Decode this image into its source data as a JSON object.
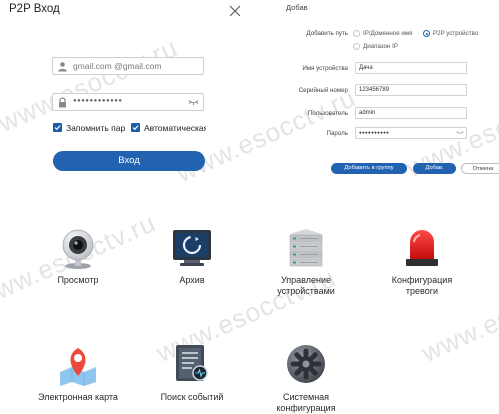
{
  "watermark": {
    "text": "www.esocctv.ru"
  },
  "login": {
    "title": "P2P Вход",
    "email_value": "gmail.com @gmail.com",
    "password_value": "●●●●●●●●●●●●",
    "remember_label": "Запомнить пар",
    "auto_label": "Автоматическая",
    "login_button": "Вход",
    "accent": "#2163b0"
  },
  "add_dialog": {
    "title": "Добав",
    "add_method_label": "Добавить путь",
    "options": {
      "ip": "IP/Доменное имя",
      "p2p": "P2P устройство",
      "range": "Диапазон IP"
    },
    "selected": "p2p",
    "fields": {
      "name": {
        "label": "Имя устройства",
        "value": "Дача"
      },
      "serial": {
        "label": "Серийный номер",
        "value": "123456789"
      },
      "user": {
        "label": "Пользователь",
        "value": "admin"
      },
      "pass": {
        "label": "Пароль",
        "value": "●●●●●●●●●●"
      }
    },
    "buttons": {
      "add_to_group": "Добавить в группу",
      "add": "Добав.",
      "cancel": "Отмена"
    }
  },
  "launcher": {
    "tiles": [
      {
        "label": "Просмотр",
        "icon": "webcam-icon"
      },
      {
        "label": "Архив",
        "icon": "archive-playback-icon"
      },
      {
        "label_1": "Управление",
        "label_2": "устройствами",
        "icon": "server-rack-icon"
      },
      {
        "label_1": "Конфигурация",
        "label_2": "тревоги",
        "icon": "alarm-siren-icon"
      },
      {
        "label": "Электронная карта",
        "icon": "map-pin-icon"
      },
      {
        "label": "Поиск событий",
        "icon": "event-search-icon"
      },
      {
        "label_1": "Системная",
        "label_2": "конфигурация",
        "icon": "system-gear-icon"
      }
    ]
  }
}
